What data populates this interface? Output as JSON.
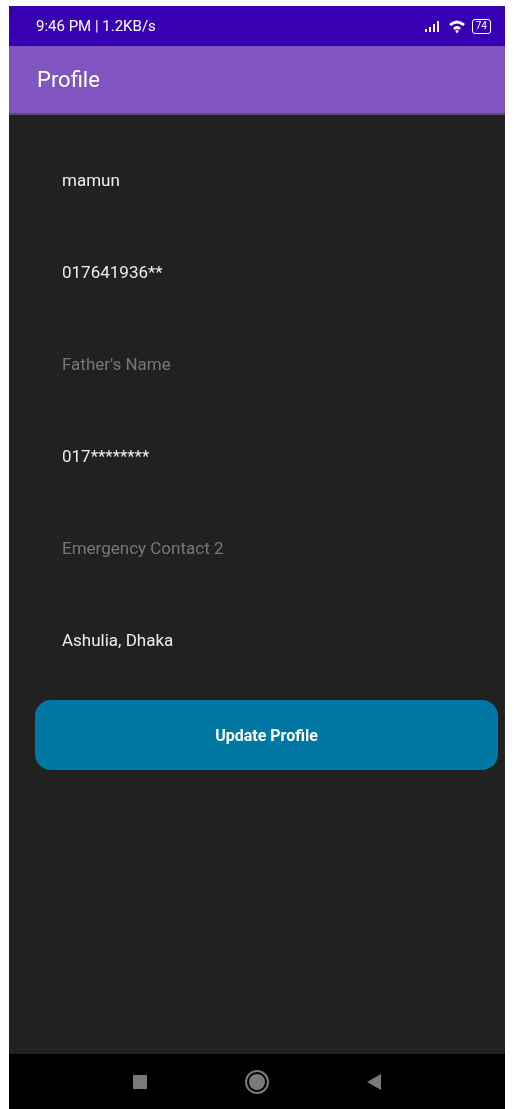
{
  "status_bar": {
    "text": "9:46 PM | 1.2KB/s",
    "battery": "74"
  },
  "app_bar": {
    "title": "Profile"
  },
  "fields": [
    {
      "value": "mamun"
    },
    {
      "value": "017641936**"
    },
    {
      "placeholder": "Father's Name"
    },
    {
      "value": "017********"
    },
    {
      "placeholder": "Emergency Contact 2"
    },
    {
      "value": "Ashulia, Dhaka"
    }
  ],
  "button": "Update Profile"
}
